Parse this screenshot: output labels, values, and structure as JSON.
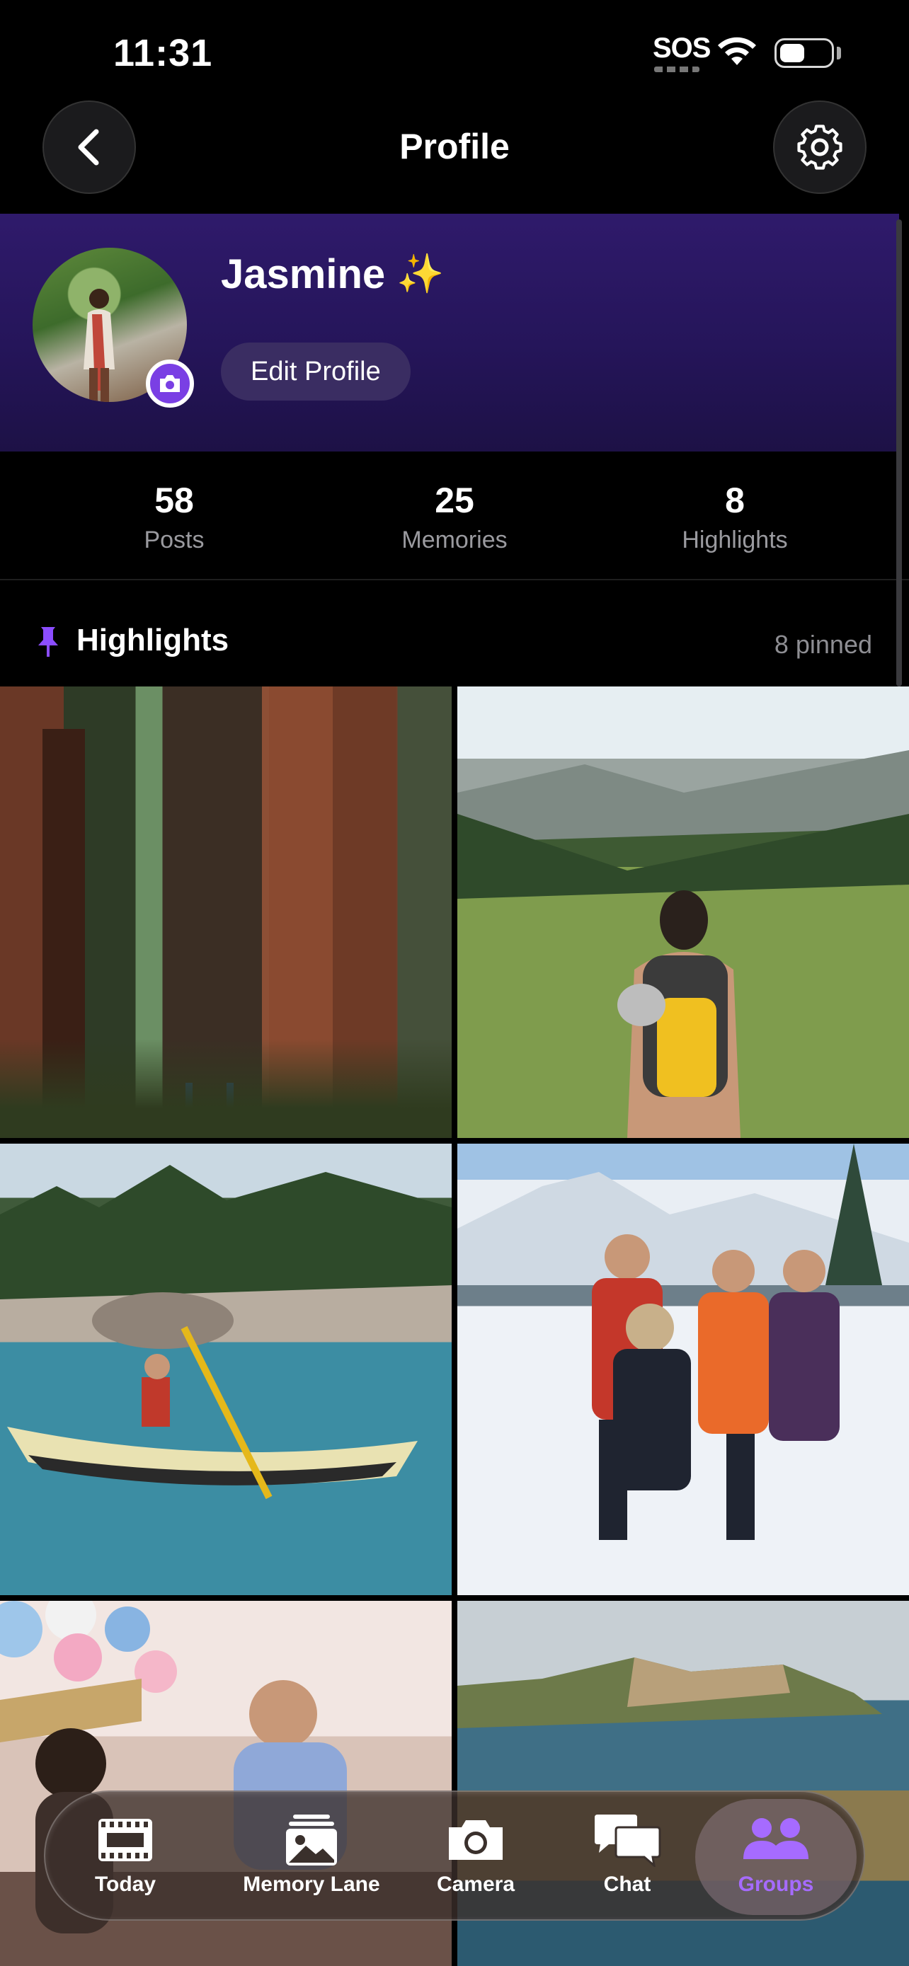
{
  "status_bar": {
    "time": "11:31",
    "sos": "SOS",
    "battery_level": 0.5
  },
  "header": {
    "title": "Profile"
  },
  "profile": {
    "name": "Jasmine",
    "name_emoji": "✨",
    "edit_label": "Edit Profile"
  },
  "stats": [
    {
      "value": "58",
      "label": "Posts"
    },
    {
      "value": "25",
      "label": "Memories"
    },
    {
      "value": "8",
      "label": "Highlights"
    }
  ],
  "highlights": {
    "title": "Highlights",
    "count_label": "8 pinned"
  },
  "tabs": [
    {
      "label": "Today",
      "icon": "film-icon"
    },
    {
      "label": "Memory Lane",
      "icon": "photos-icon"
    },
    {
      "label": "Camera",
      "icon": "camera-icon"
    },
    {
      "label": "Chat",
      "icon": "chat-bubbles-icon"
    },
    {
      "label": "Groups",
      "icon": "people-icon",
      "active": true
    }
  ],
  "colors": {
    "accent": "#a66bff",
    "banner": "#2f1a6b",
    "background": "#000000"
  }
}
